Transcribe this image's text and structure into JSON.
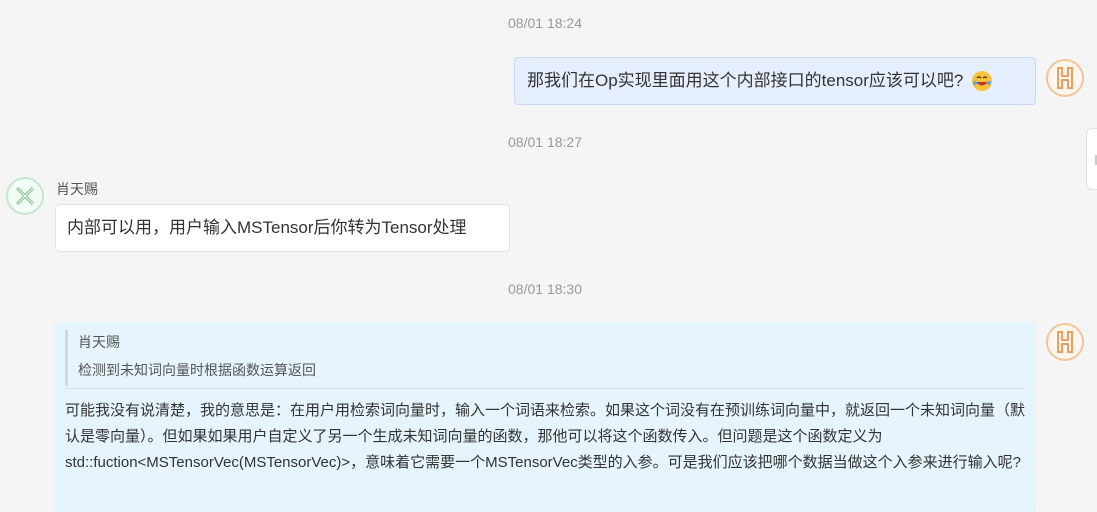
{
  "messages": {
    "ts1": "08/01 18:24",
    "outgoing1": {
      "text": "那我们在Op实现里面用这个内部接口的tensor应该可以吧?",
      "emoji_icon": "laughing-face-icon"
    },
    "ts2": "08/01 18:27",
    "incoming1": {
      "sender": "肖天赐",
      "text": "内部可以用，用户输入MSTensor后你转为Tensor处理"
    },
    "ts3": "08/01 18:30",
    "outgoing2": {
      "quote_sender": "肖天赐",
      "quote_text": "检测到未知词向量时根据函数运算返回",
      "text": "可能我没有说清楚，我的意思是：在用户用检索词向量时，输入一个词语来检索。如果这个词没有在预训练词向量中，就返回一个未知词向量（默认是零向量）。但如果如果用户自定义了另一个生成未知词向量的函数，那他可以将这个函数传入。但问题是这个函数定义为std::fuction<MSTensorVec(MSTensorVec)>，意味着它需要一个MSTensorVec类型的入参。可是我们应该把哪个数据当做这个入参来进行输入呢?"
    }
  },
  "avatars": {
    "self_letter": "H",
    "self_color": "#e8a062",
    "other_letter": "X",
    "other_color": "#6cbf84"
  }
}
